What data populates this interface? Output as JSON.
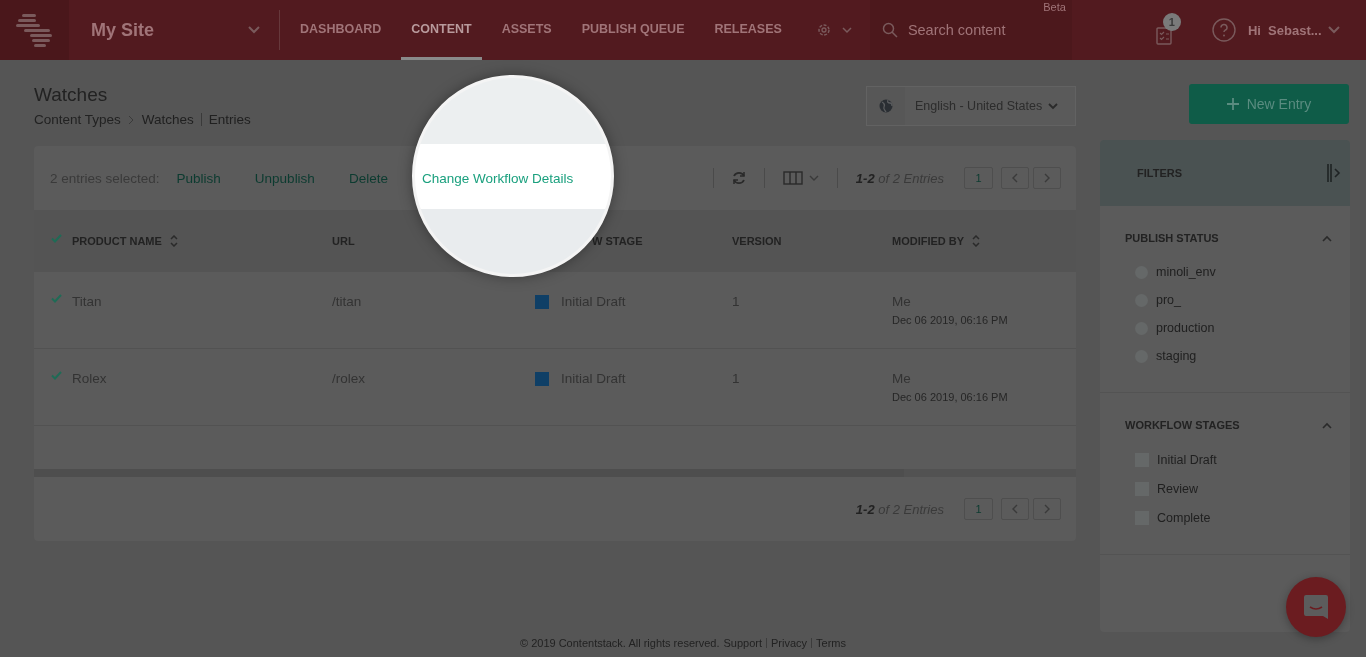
{
  "header": {
    "site": "My Site",
    "nav": [
      {
        "label": "DASHBOARD",
        "selected": false
      },
      {
        "label": "CONTENT",
        "selected": true
      },
      {
        "label": "ASSETS",
        "selected": false
      },
      {
        "label": "PUBLISH QUEUE",
        "selected": false
      },
      {
        "label": "RELEASES",
        "selected": false
      }
    ],
    "search": {
      "placeholder": "Search content",
      "badge": "Beta"
    },
    "tasks_count": "1",
    "user": "Hi  Sebast..."
  },
  "page": {
    "title": "Watches",
    "breadcrumb": [
      "Content Types",
      "Watches",
      "Entries"
    ],
    "locale": "English - United States",
    "new_button": "New Entry"
  },
  "toolbar": {
    "selection": "2 entries selected:",
    "actions": [
      {
        "label": "Publish",
        "highlighted": false
      },
      {
        "label": "Unpublish",
        "highlighted": false
      },
      {
        "label": "Delete",
        "highlighted": false
      },
      {
        "label": "Change Workflow Details",
        "highlighted": true
      }
    ],
    "range": "1-2",
    "of": "of 2 Entries",
    "page": "1"
  },
  "table": {
    "columns": [
      {
        "label": "PRODUCT NAME",
        "sortable": true
      },
      {
        "label": "URL",
        "sortable": false
      },
      {
        "label": "W STAGE",
        "sortable": false
      },
      {
        "label": "VERSION",
        "sortable": false
      },
      {
        "label": "MODIFIED BY",
        "sortable": true
      }
    ],
    "rows": [
      {
        "selected": true,
        "name": "Titan",
        "url": "/titan",
        "stage": "Initial Draft",
        "color": "#0f3f66",
        "version": "1",
        "modified_by": "Me",
        "modified_at": "Dec 06 2019, 06:16 PM"
      },
      {
        "selected": true,
        "name": "Rolex",
        "url": "/rolex",
        "stage": "Initial Draft",
        "color": "#0f3f66",
        "version": "1",
        "modified_by": "Me",
        "modified_at": "Dec 06 2019, 06:16 PM"
      }
    ]
  },
  "pager": {
    "range": "1-2",
    "of": "of 2 Entries",
    "page": "1"
  },
  "filters": {
    "title": "FILTERS",
    "sections": [
      {
        "title": "PUBLISH STATUS",
        "kind": "radio",
        "expanded": true,
        "options": [
          {
            "label": "minoli_env",
            "checked": false
          },
          {
            "label": "pro_",
            "checked": false
          },
          {
            "label": "production",
            "checked": false
          },
          {
            "label": "staging",
            "checked": false
          }
        ]
      },
      {
        "title": "WORKFLOW STAGES",
        "kind": "checkbox",
        "expanded": true,
        "options": [
          {
            "label": "Initial Draft",
            "checked": false
          },
          {
            "label": "Review",
            "checked": false
          },
          {
            "label": "Complete",
            "checked": false
          }
        ]
      }
    ]
  },
  "footer": {
    "copyright": "© 2019 Contentstack. All rights reserved.",
    "links": [
      "Support",
      "Privacy",
      "Terms"
    ]
  }
}
